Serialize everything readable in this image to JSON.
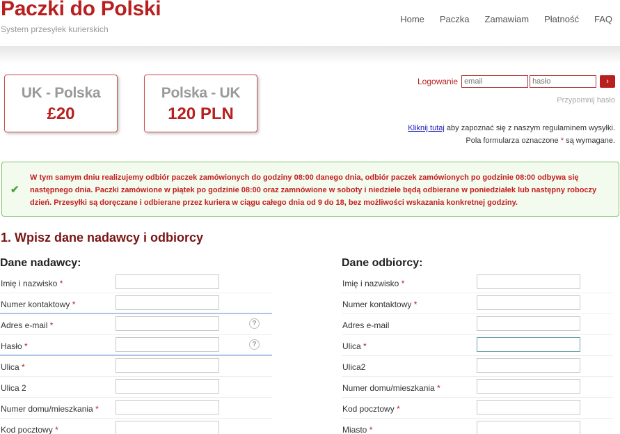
{
  "header": {
    "logo_title": "Paczki do Polski",
    "logo_subtitle": "System przesyłek kurierskich",
    "nav": [
      "Home",
      "Paczka",
      "Zamawiam",
      "Płatność",
      "FAQ"
    ]
  },
  "prices": [
    {
      "route": "UK - Polska",
      "price": "£20"
    },
    {
      "route": "Polska - UK",
      "price": "120 PLN"
    }
  ],
  "login": {
    "label": "Logowanie",
    "email_placeholder": "email",
    "password_placeholder": "hasło",
    "remind_link": "Przypomnij hasło",
    "go_symbol": "›"
  },
  "terms": {
    "link": "Kliknij tutaj",
    "text": "aby zapoznać się z naszym regulaminem wysyłki.",
    "required_prefix": "Pola formularza oznaczone",
    "required_star": "*",
    "required_suffix": "są wymagane."
  },
  "notice": {
    "text": "W tym samym dniu realizujemy odbiór paczek zamówionych do godziny 08:00 danego dnia, odbiór paczek zamówionych po godzinie 08:00 odbywa się następnego dnia. Paczki zamówione w piątek po godzinie 08:00 oraz zamnówione w soboty i niedziele będą odbierane w poniedziałek lub następny roboczy dzień. Przesyłki są doręczane i odbierane przez kuriera w ciągu całego dnia od 9 do 18, bez możliwości wskazania konkretnej godziny."
  },
  "section_title": "1. Wpisz dane nadawcy i odbiorcy",
  "sender": {
    "title": "Dane nadawcy:",
    "fields": [
      {
        "label": "Imię i nazwisko",
        "required": "*"
      },
      {
        "label": "Numer kontaktowy",
        "required": "*"
      },
      {
        "label": "Adres e-mail",
        "required": "*",
        "help": "?"
      },
      {
        "label": "Hasło",
        "required": "*",
        "help": "?"
      },
      {
        "label": "Ulica",
        "required": "*"
      },
      {
        "label": "Ulica 2",
        "required": ""
      },
      {
        "label": "Numer domu/mieszkania",
        "required": "*"
      },
      {
        "label": "Kod pocztowy",
        "required": "*"
      }
    ]
  },
  "receiver": {
    "title": "Dane odbiorcy:",
    "fields": [
      {
        "label": "Imię i nazwisko",
        "required": "*"
      },
      {
        "label": "Numer kontaktowy",
        "required": "*"
      },
      {
        "label": "Adres e-mail",
        "required": ""
      },
      {
        "label": "Ulica",
        "required": "*"
      },
      {
        "label": "Ulica2",
        "required": ""
      },
      {
        "label": "Numer domu/mieszkania",
        "required": "*"
      },
      {
        "label": "Kod pocztowy",
        "required": "*"
      },
      {
        "label": "Miasto",
        "required": "*"
      }
    ]
  },
  "colors": {
    "brand_red": "#b81f1f",
    "notice_green": "#7fc36b",
    "notice_bg": "#f3fbef"
  }
}
